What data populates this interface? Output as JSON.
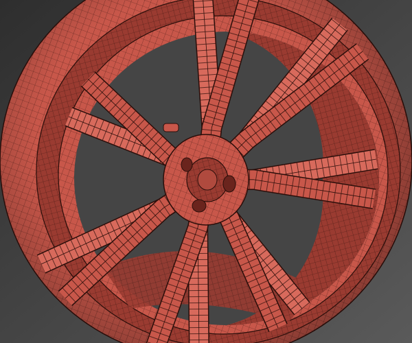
{
  "scene": {
    "subject": "wheel-rim-wireframe",
    "colors": {
      "background_top": "#2e2e2e",
      "background_bottom": "#5a5a5a",
      "surface": "#c8574a",
      "surface_light": "#d86a5c",
      "surface_dark": "#7a2a22",
      "barrel_inner": "#5e1f19",
      "wire": "#2a0e0a"
    }
  }
}
